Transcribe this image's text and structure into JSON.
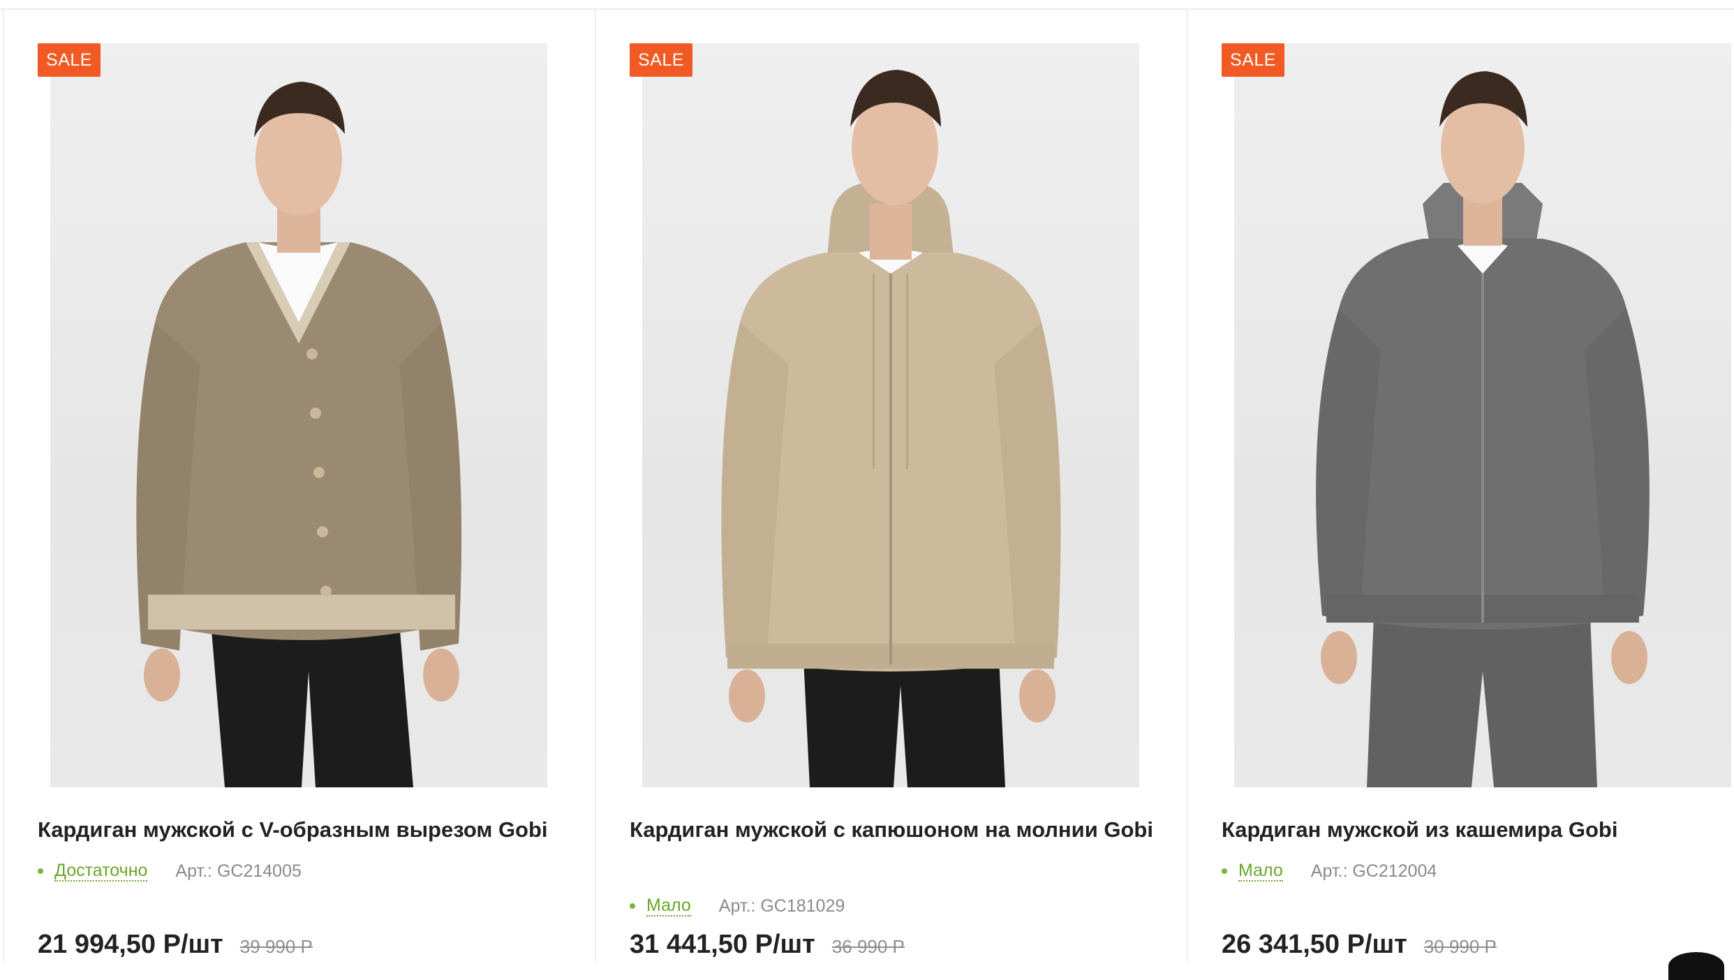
{
  "products": [
    {
      "badge": "SALE",
      "title": "Кардиган мужской с V-образным вырезом Gobi",
      "stock": "Достаточно",
      "sku": "Арт.: GC214005",
      "price": "21 994,50 Р/шт",
      "old_price": "39 990 Р",
      "color": "#9b8a72"
    },
    {
      "badge": "SALE",
      "title": "Кардиган мужской с капюшоном на молнии Gobi",
      "stock": "Мало",
      "sku": "Арт.: GC181029",
      "price": "31 441,50 Р/шт",
      "old_price": "36 990 Р",
      "color": "#cdb99c"
    },
    {
      "badge": "SALE",
      "title": "Кардиган мужской из кашемира Gobi",
      "stock": "Мало",
      "sku": "Арт.: GC212004",
      "price": "26 341,50 Р/шт",
      "old_price": "30 990 Р",
      "color": "#6f6f6f"
    }
  ],
  "colors": {
    "sale_badge": "#f15a24",
    "stock_ok": "#6aa529",
    "text": "#222222",
    "muted": "#8a8a8a"
  }
}
